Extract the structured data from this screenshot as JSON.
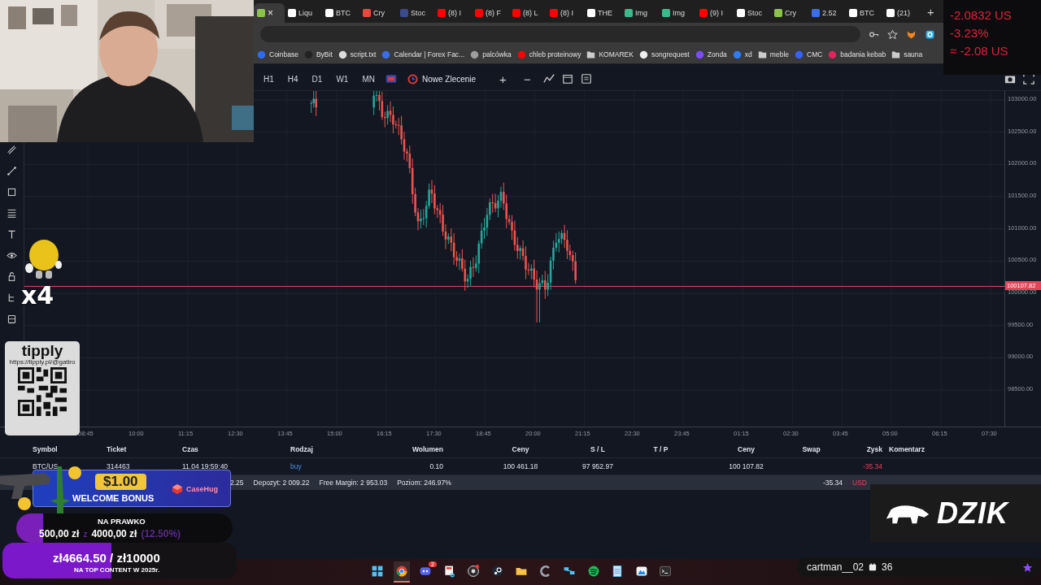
{
  "browser": {
    "tabs": [
      {
        "selected": true,
        "color": "#8bc34a",
        "close": "×"
      },
      {
        "label": "Liqu",
        "selected": false,
        "color": "#ffffff"
      },
      {
        "label": "BTC",
        "selected": false,
        "color": "#ffffff"
      },
      {
        "label": "Cry",
        "selected": false,
        "color": "#e8483b"
      },
      {
        "label": "Stoc",
        "selected": false,
        "color": "#3b4a8a"
      },
      {
        "label": "(8) I",
        "selected": false,
        "color": "#ff0000"
      },
      {
        "label": "(8) F",
        "selected": false,
        "color": "#ff0000"
      },
      {
        "label": "(8) L",
        "selected": false,
        "color": "#ff0000"
      },
      {
        "label": "(8) I",
        "selected": false,
        "color": "#ff0000"
      },
      {
        "label": "THE",
        "selected": false,
        "color": "#ffffff"
      },
      {
        "label": "Img",
        "selected": false,
        "color": "#3dba8c"
      },
      {
        "label": "Img",
        "selected": false,
        "color": "#3dba8c"
      },
      {
        "label": "(9) I",
        "selected": false,
        "color": "#ff0000"
      },
      {
        "label": "Stoc",
        "selected": false,
        "color": "#ffffff"
      },
      {
        "label": "Cry",
        "selected": false,
        "color": "#8bc34a"
      },
      {
        "label": "2.52",
        "selected": false,
        "color": "#3a6ee8"
      },
      {
        "label": "BTC",
        "selected": false,
        "color": "#ffffff"
      },
      {
        "label": "(21)",
        "selected": false,
        "color": "#ffffff"
      }
    ],
    "new_tab": "+",
    "bookmarks": [
      {
        "label": "Coinbase",
        "kind": "site",
        "color": "#2f6cf6"
      },
      {
        "label": "ByBit",
        "kind": "site",
        "color": "#222222"
      },
      {
        "label": "script.txt",
        "kind": "site",
        "color": "#dddddd"
      },
      {
        "label": "Calendar | Forex Fac...",
        "kind": "site",
        "color": "#3a6ee8"
      },
      {
        "label": "palcówka",
        "kind": "site",
        "color": "#9e9e9e"
      },
      {
        "label": "chleb proteinowy",
        "kind": "site",
        "color": "#ff0000"
      },
      {
        "label": "KOMAREK",
        "kind": "folder",
        "color": "#cccccc"
      },
      {
        "label": "songrequest",
        "kind": "site",
        "color": "#eeeeee"
      },
      {
        "label": "Zonda",
        "kind": "site",
        "color": "#7c4dff"
      },
      {
        "label": "xd",
        "kind": "site",
        "color": "#2f7cf6"
      },
      {
        "label": "meble",
        "kind": "folder",
        "color": "#cccccc"
      },
      {
        "label": "CMC",
        "kind": "site",
        "color": "#3861fb"
      },
      {
        "label": "badania kebab",
        "kind": "site",
        "color": "#e0245e"
      },
      {
        "label": "sauna",
        "kind": "folder",
        "color": "#cccccc"
      }
    ]
  },
  "ticker": [
    "-2.0832 US",
    "-3.23%",
    "≈ -2.08 US"
  ],
  "toolbar": {
    "timeframes": [
      "H1",
      "H4",
      "D1",
      "W1",
      "MN"
    ],
    "order_button": "Nowe Zlecenie",
    "zoom_in": "+",
    "zoom_out": "−"
  },
  "chart": {
    "y_labels": [
      "103000.00",
      "102500.00",
      "102000.00",
      "101500.00",
      "101000.00",
      "100500.00",
      "100000.00",
      "99500.00",
      "99000.00",
      "98500.00"
    ],
    "price_tag": "100107.82",
    "x_labels": [
      "08:45",
      "10:00",
      "11:15",
      "12:30",
      "13:45",
      "15:00",
      "16:15",
      "17:30",
      "18:45",
      "20:00",
      "21:15",
      "22:30",
      "23:45",
      "01:15",
      "02:30",
      "03:45",
      "05:00",
      "06:15",
      "07:30"
    ]
  },
  "table": {
    "columns": [
      "Symbol",
      "Ticket",
      "Czas",
      "Rodzaj",
      "Wolumen",
      "Ceny",
      "S / L",
      "T / P",
      "Ceny",
      "Swap",
      "Zysk",
      "Komentarz"
    ],
    "rows": [
      [
        "BTC/US",
        "314463",
        "11.04 19:59:40",
        "buy",
        "0.10",
        "100 461.18",
        "97 952.97",
        "",
        "100 107.82",
        "",
        "-35.34",
        ""
      ]
    ],
    "summary": {
      "items": [
        "2.25",
        "Depozyt: 2 009.22",
        "Free Margin: 2 953.03",
        "Poziom: 246.97%"
      ],
      "total": "-35.34",
      "currency": "USD"
    }
  },
  "overlays": {
    "multiplier": "x4",
    "tipply": {
      "logo": "tipply",
      "url": "https://tipply.pl/@gatiro"
    },
    "promo": {
      "price": "$1.00",
      "headline": "WELCOME BONUS",
      "brand": "CaseHug"
    },
    "goal_1": {
      "title": "NA PRAWKO",
      "current": "500,00 zł",
      "separator": "z",
      "target": "4000,00 zł",
      "percent": "(12.50%)",
      "level": 0.125
    },
    "goal_2": {
      "amount": "zł4664.50 / zł10000",
      "title": "NA TOP CONTENT W 2025r.",
      "level": 0.466
    },
    "sponsor": "DZIK",
    "chat": {
      "user": "cartman__02",
      "count": "36"
    }
  },
  "taskbar": [
    {
      "kind": "windows",
      "selected": false
    },
    {
      "kind": "chrome",
      "selected": true
    },
    {
      "kind": "discord",
      "selected": false,
      "badge": "2"
    },
    {
      "kind": "snip",
      "selected": false
    },
    {
      "kind": "obs",
      "selected": false
    },
    {
      "kind": "steam",
      "selected": false
    },
    {
      "kind": "folder",
      "selected": false
    },
    {
      "kind": "ccleaner",
      "selected": false
    },
    {
      "kind": "network",
      "selected": false
    },
    {
      "kind": "spotify",
      "selected": false
    },
    {
      "kind": "notepad",
      "selected": false
    },
    {
      "kind": "photos",
      "selected": false
    },
    {
      "kind": "terminal",
      "selected": false
    }
  ]
}
